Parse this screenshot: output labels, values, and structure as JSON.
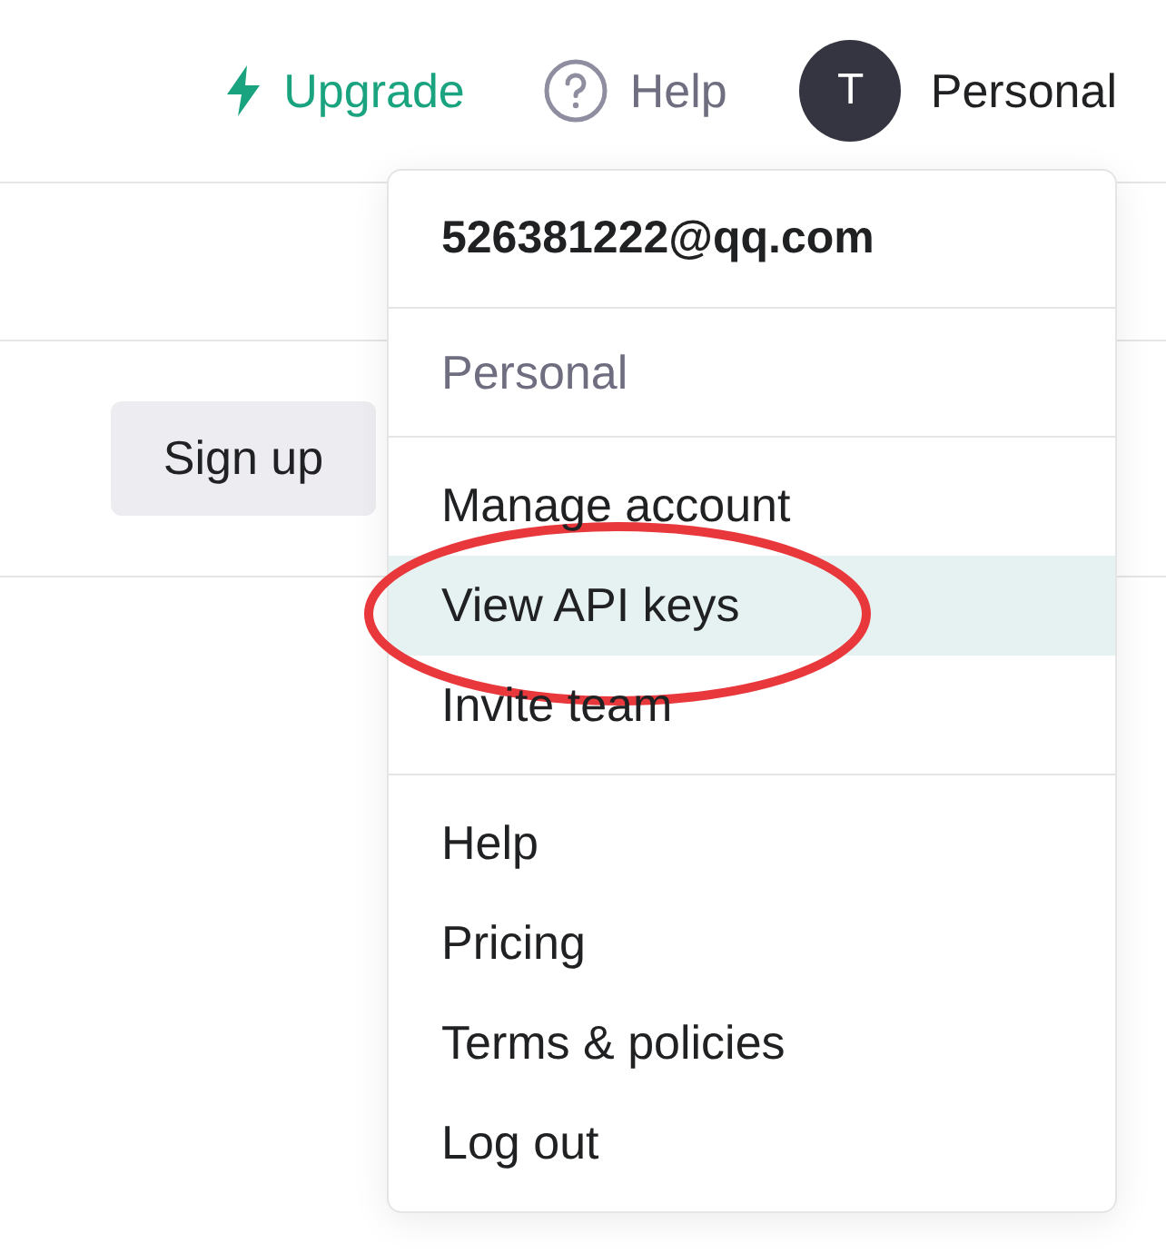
{
  "header": {
    "upgrade": "Upgrade",
    "help": "Help",
    "avatar_initial": "T",
    "account": "Personal"
  },
  "sign_up": "Sign up",
  "menu": {
    "email": "526381222@qq.com",
    "workspace": "Personal",
    "groups": [
      {
        "items": [
          {
            "label": "Manage account",
            "selected": false
          },
          {
            "label": "View API keys",
            "selected": true
          },
          {
            "label": "Invite team",
            "selected": false
          }
        ]
      },
      {
        "items": [
          {
            "label": "Help",
            "selected": false
          },
          {
            "label": "Pricing",
            "selected": false
          },
          {
            "label": "Terms & policies",
            "selected": false
          },
          {
            "label": "Log out",
            "selected": false
          }
        ]
      }
    ]
  }
}
